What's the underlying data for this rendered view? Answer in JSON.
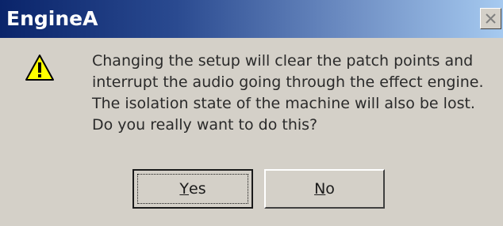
{
  "window": {
    "title": "EngineA",
    "close_icon": "close-icon",
    "colors": {
      "title_bar_start": "#0a246a",
      "title_bar_end": "#a6caf0",
      "dialog_background": "#d4d0c8"
    }
  },
  "message": {
    "icon": "warning-icon",
    "lines": [
      "Changing the setup will clear the patch points and",
      "interrupt the audio going through the effect engine.",
      "The isolation state of the machine will also be lost.",
      "Do you really want to do this?"
    ]
  },
  "buttons": {
    "yes": {
      "mnemonic": "Y",
      "rest": "es"
    },
    "no": {
      "mnemonic": "N",
      "rest": "o"
    }
  }
}
